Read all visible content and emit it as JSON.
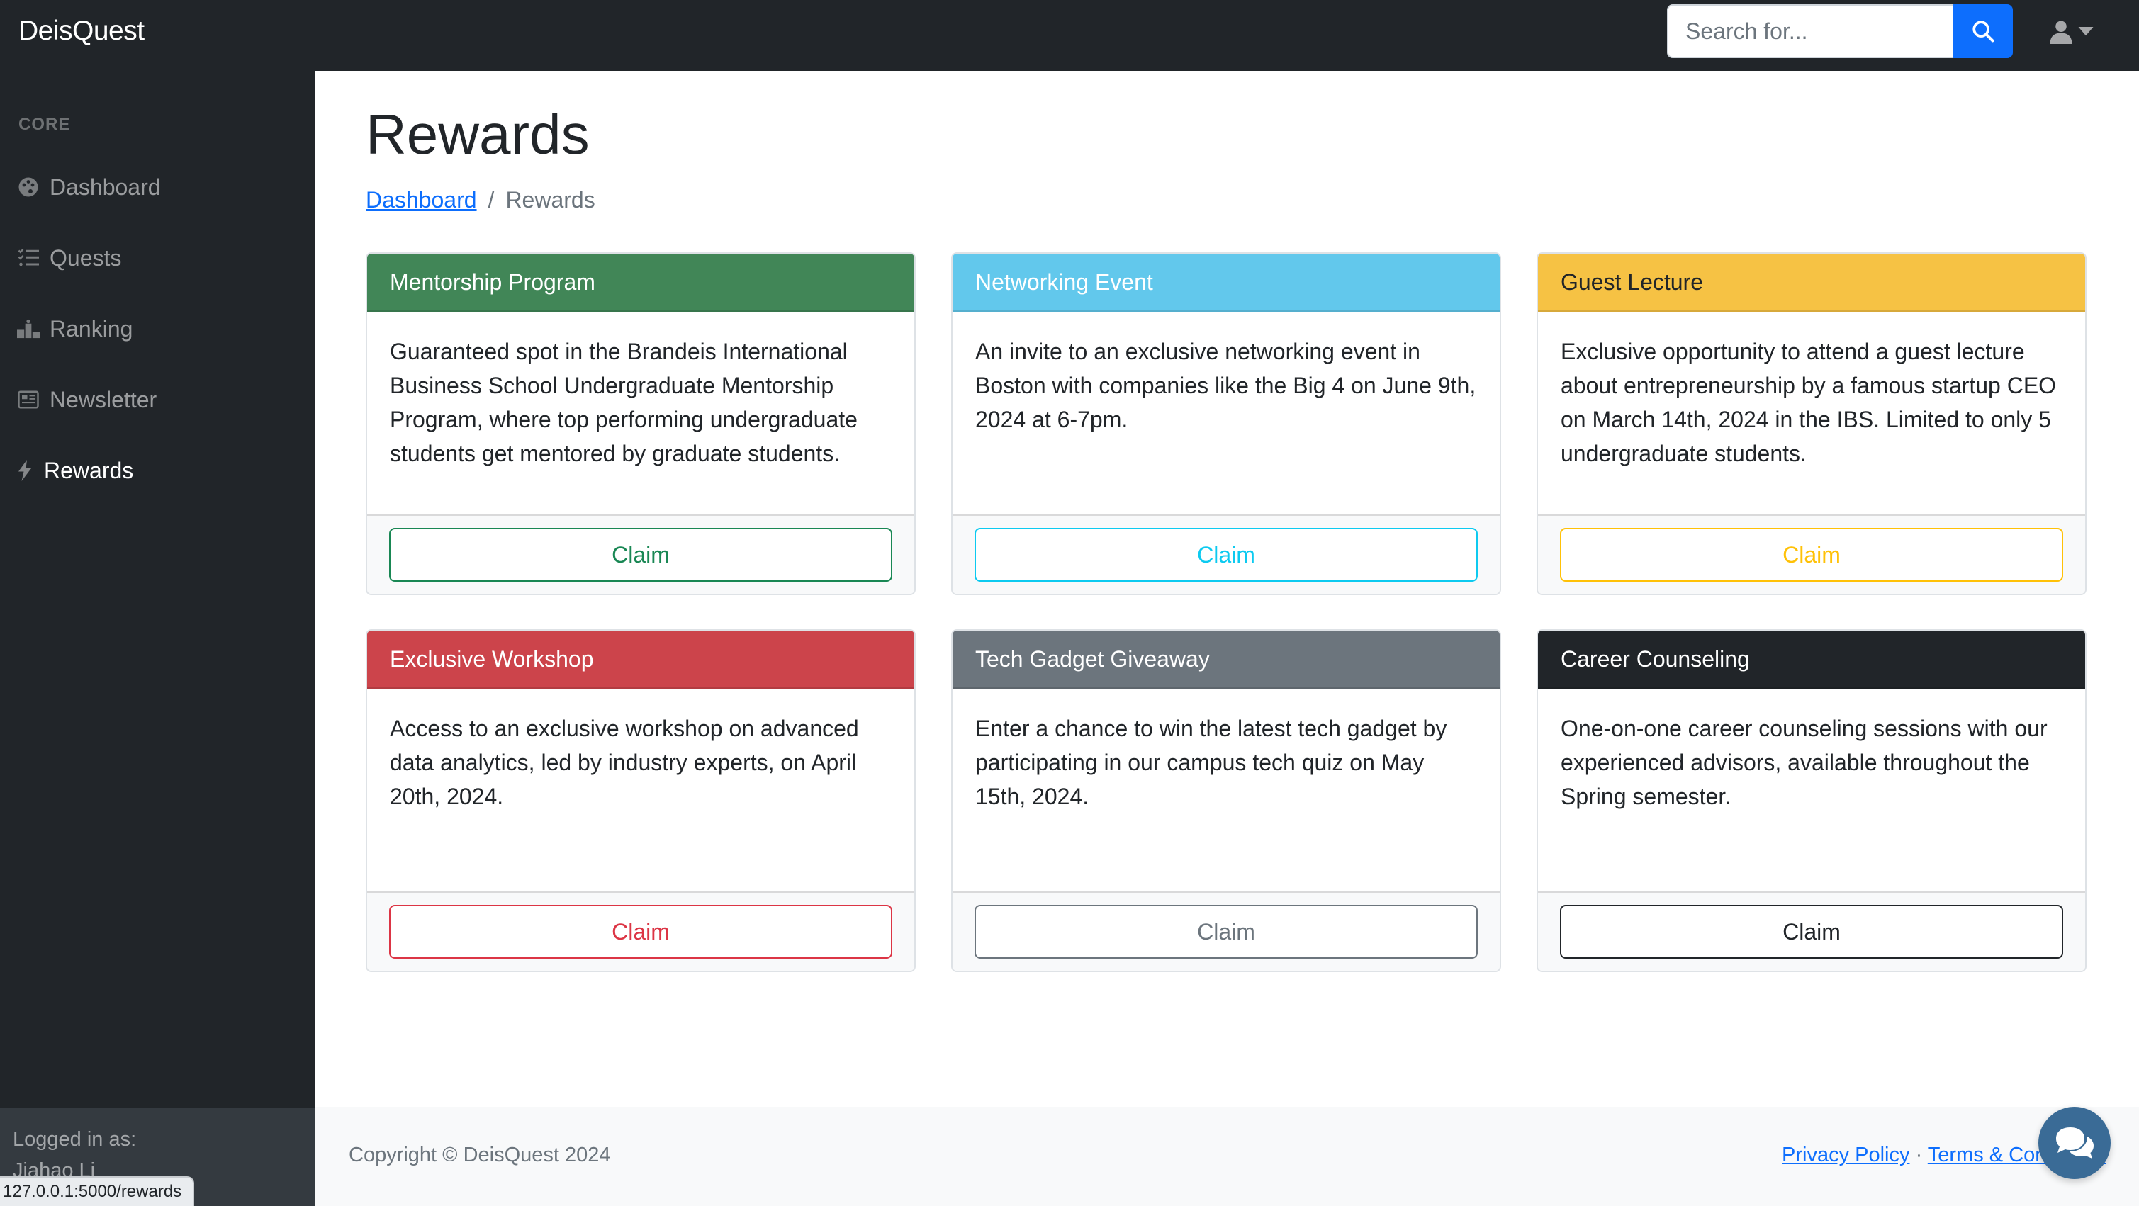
{
  "app": {
    "brand": "DeisQuest"
  },
  "search": {
    "placeholder": "Search for...",
    "value": ""
  },
  "sidebar": {
    "heading": "CORE",
    "items": [
      {
        "label": "Dashboard",
        "icon": "palette-icon",
        "active": false
      },
      {
        "label": "Quests",
        "icon": "list-check-icon",
        "active": false
      },
      {
        "label": "Ranking",
        "icon": "podium-icon",
        "active": false
      },
      {
        "label": "Newsletter",
        "icon": "newspaper-icon",
        "active": false
      },
      {
        "label": "Rewards",
        "icon": "bolt-icon",
        "active": true
      }
    ],
    "footer": {
      "label": "Logged in as:",
      "user": "Jiahao Li"
    }
  },
  "status_url": "127.0.0.1:5000/rewards",
  "page": {
    "title": "Rewards",
    "breadcrumb": {
      "link": "Dashboard",
      "current": "Rewards"
    }
  },
  "rewards": [
    {
      "title": "Mentorship Program",
      "description": "Guaranteed spot in the Brandeis International Business School Undergraduate Mentorship Program, where top performing undergraduate students get mentored by graduate students.",
      "button": "Claim",
      "color": "#198754"
    },
    {
      "title": "Networking Event",
      "description": "An invite to an exclusive networking event in Boston with companies like the Big 4 on June 9th, 2024 at 6-7pm.",
      "button": "Claim",
      "color": "#0dcaf0"
    },
    {
      "title": "Guest Lecture",
      "description": "Exclusive opportunity to attend a guest lecture about entrepreneurship by a famous startup CEO on March 14th, 2024 in the IBS. Limited to only 5 undergraduate students.",
      "button": "Claim",
      "color": "#ffc107"
    },
    {
      "title": "Exclusive Workshop",
      "description": "Access to an exclusive workshop on advanced data analytics, led by industry experts, on April 20th, 2024.",
      "button": "Claim",
      "color": "#dc3545"
    },
    {
      "title": "Tech Gadget Giveaway",
      "description": "Enter a chance to win the latest tech gadget by participating in our campus tech quiz on May 15th, 2024.",
      "button": "Claim",
      "color": "#6c757d"
    },
    {
      "title": "Career Counseling",
      "description": "One-on-one career counseling sessions with our experienced advisors, available throughout the Spring semester.",
      "button": "Claim",
      "color": "#212529"
    }
  ],
  "footer": {
    "copyright": "Copyright © DeisQuest 2024",
    "privacy": "Privacy Policy",
    "separator": "·",
    "terms": "Terms & Conditions"
  },
  "colors": {
    "primary": "#0d6efd",
    "navbar": "#212529",
    "success": "#198754",
    "info": "#0dcaf0",
    "warning": "#ffc107",
    "danger": "#dc3545",
    "secondary": "#6c757d",
    "dark": "#212529"
  }
}
